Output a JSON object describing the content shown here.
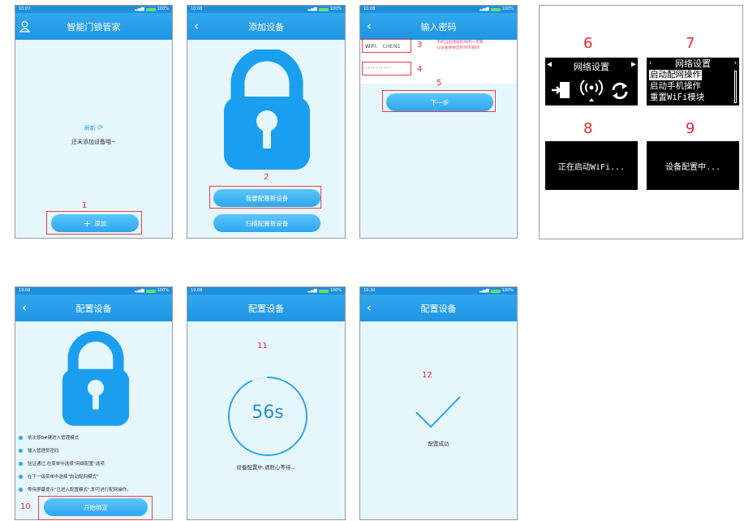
{
  "screens": {
    "s1": {
      "status_time": "10:07",
      "status_battery": "100%",
      "title": "智能门锁管家",
      "refresh_label": "刷新",
      "empty_text": "还未添加设备哦~",
      "add_button": "添加",
      "step": "1"
    },
    "s2": {
      "status_time": "10:08",
      "status_battery": "100%",
      "title": "添加设备",
      "step": "2",
      "config_new_button": "我要配置新设备",
      "scan_button": "扫描配置新设备"
    },
    "s3": {
      "status_time": "10:08",
      "status_battery": "100%",
      "title": "输入密码",
      "wifi_label": "WiFi:",
      "wifi_value": "CHEN1",
      "hint_line1": "手机当前连接的WiFi一定要",
      "hint_line2": "与设备要绑定的WiFi相同",
      "password_mask": "··········",
      "next_button": "下一步",
      "step_wifi": "3",
      "step_password": "4",
      "step_next": "5"
    },
    "panel": {
      "n6": "6",
      "n7": "7",
      "n8": "8",
      "n9": "9",
      "oled6_title": "网络设置",
      "oled7_title": "网络设置",
      "oled7_item1": "启动配网操作",
      "oled7_item2": "启动手机操作",
      "oled7_item3": "重置WiFi模块",
      "oled8_text": "正在启动WiFi...",
      "oled9_text": "设备配置中..."
    },
    "s4": {
      "status_time": "19:08",
      "status_battery": "100%",
      "title": "配置设备",
      "instructions": [
        "依次按0#键进入管理模式",
        "输入管理员密码",
        "验证通过,在菜单中选择\"网络配置\"选项",
        "在下一级菜单中选择\"启动配网模式\"",
        "等待屏幕提示\"已进入配置模式\",即可进行配网操作。"
      ],
      "start_button": "开始绑定",
      "step": "10"
    },
    "s5": {
      "status_time": "19:08",
      "status_battery": "100%",
      "title": "配置设备",
      "step": "11",
      "countdown": "56s",
      "countdown_progress": 0.93,
      "waiting_text": "设备配置中,请耐心等待..."
    },
    "s6": {
      "status_time": "19:30",
      "status_battery": "100%",
      "title": "配置设备",
      "step": "12",
      "success_text": "配置成功"
    }
  },
  "colors": {
    "accent": "#1f95e4",
    "lock": "#1a9ff0",
    "annotation": "#e32a30",
    "screen_bg": "#e6f6fd"
  }
}
